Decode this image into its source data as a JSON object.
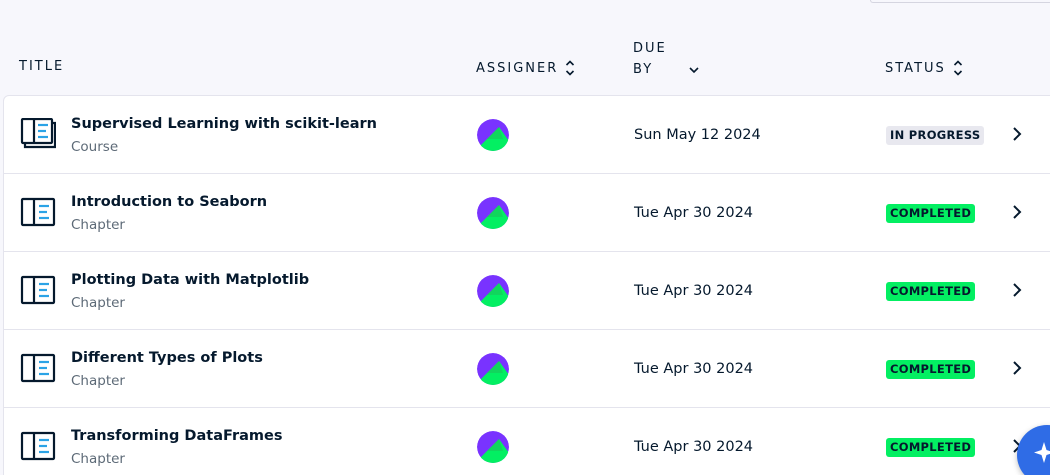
{
  "header": {
    "title_label": "TITLE",
    "assigner_label": "ASSIGNER",
    "due_label_line1": "DUE",
    "due_label_line2": "BY",
    "status_label": "STATUS"
  },
  "rows": [
    {
      "title": "Supervised Learning with scikit-learn",
      "type": "Course",
      "due": "Sun May 12 2024",
      "status": "IN PROGRESS",
      "status_kind": "progress",
      "icon": "course-icon"
    },
    {
      "title": "Introduction to Seaborn",
      "type": "Chapter",
      "due": "Tue Apr 30 2024",
      "status": "COMPLETED",
      "status_kind": "completed",
      "icon": "chapter-icon"
    },
    {
      "title": "Plotting Data with Matplotlib",
      "type": "Chapter",
      "due": "Tue Apr 30 2024",
      "status": "COMPLETED",
      "status_kind": "completed",
      "icon": "chapter-icon"
    },
    {
      "title": "Different Types of Plots",
      "type": "Chapter",
      "due": "Tue Apr 30 2024",
      "status": "COMPLETED",
      "status_kind": "completed",
      "icon": "chapter-icon"
    },
    {
      "title": "Transforming DataFrames",
      "type": "Chapter",
      "due": "Tue Apr 30 2024",
      "status": "COMPLETED",
      "status_kind": "completed",
      "icon": "chapter-icon"
    }
  ],
  "colors": {
    "completed_badge": "#03ef62",
    "progress_badge": "#e8e8ef",
    "icon_accent": "#2ba3e6",
    "avatar_purple": "#7933ff",
    "avatar_green": "#03ef62",
    "fab_blue": "#2f6ce6"
  },
  "icons": {
    "sort": "sort-icon",
    "row_chevron": "chevron-right-icon",
    "fab": "ai-sparkle-icon"
  }
}
